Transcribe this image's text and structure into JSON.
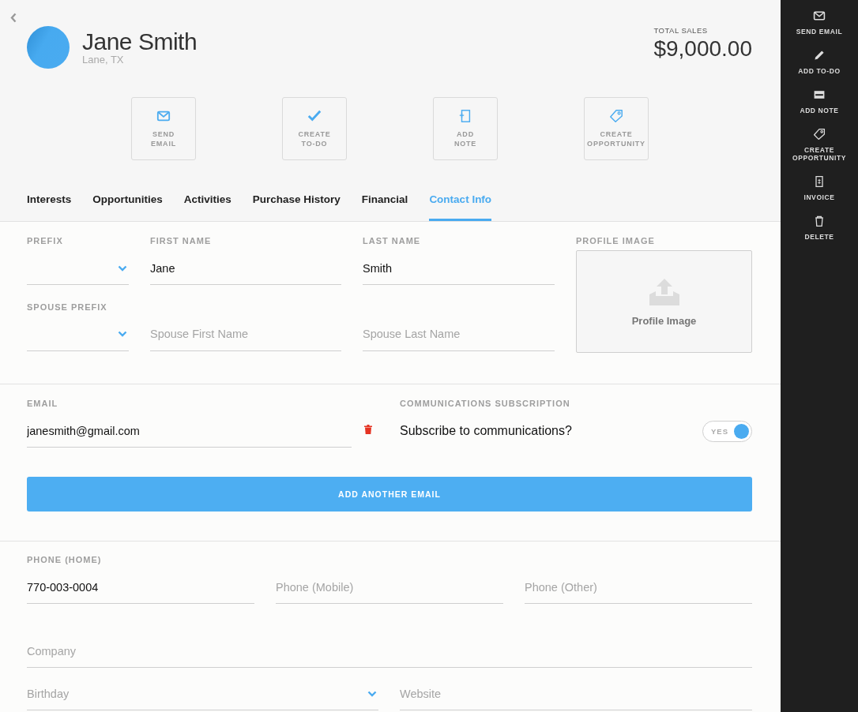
{
  "contact": {
    "name": "Jane Smith",
    "location": "Lane, TX"
  },
  "total_sales": {
    "label": "TOTAL SALES",
    "amount": "$9,000.00"
  },
  "actions": [
    {
      "label": "SEND\nEMAIL",
      "kind": "mail"
    },
    {
      "label": "CREATE\nTO-DO",
      "kind": "check"
    },
    {
      "label": "ADD\nNOTE",
      "kind": "note"
    },
    {
      "label": "CREATE\nOPPORTUNITY",
      "kind": "tag"
    }
  ],
  "tabs": [
    {
      "label": "Interests",
      "selected": false
    },
    {
      "label": "Opportunities",
      "selected": false
    },
    {
      "label": "Activities",
      "selected": false
    },
    {
      "label": "Purchase History",
      "selected": false
    },
    {
      "label": "Financial",
      "selected": false
    },
    {
      "label": "Contact Info",
      "selected": true
    }
  ],
  "name_fields": [
    {
      "label": "PREFIX",
      "kind": "select"
    },
    {
      "label": "FIRST NAME",
      "kind": "text",
      "value": "Jane"
    },
    {
      "label": "LAST NAME",
      "kind": "text",
      "value": "Smith"
    },
    {
      "label": "SPOUSE PREFIX",
      "kind": "select"
    },
    {
      "kind": "text",
      "placeholder": "Spouse First Name"
    },
    {
      "kind": "text",
      "placeholder": "Spouse Last Name"
    }
  ],
  "profile_image": {
    "label": "PROFILE IMAGE",
    "caption": "Profile Image"
  },
  "email": {
    "label": "EMAIL",
    "value": "janesmith@gmail.com"
  },
  "subscription": {
    "label": "COMMUNICATIONS SUBSCRIPTION",
    "question": "Subscribe to communications?",
    "toggle": {
      "label": "YES",
      "on": true
    }
  },
  "add_email_button": "ADD ANOTHER EMAIL",
  "phone_fields": [
    {
      "label": "PHONE (HOME)",
      "kind": "text",
      "value": "770-003-0004"
    },
    {
      "kind": "text",
      "placeholder": "Phone (Mobile)"
    },
    {
      "kind": "text",
      "placeholder": "Phone (Other)"
    }
  ],
  "company": {
    "kind": "text",
    "placeholder": "Company"
  },
  "bottom_fields": [
    {
      "kind": "select",
      "placeholder": "Birthday"
    },
    {
      "kind": "text",
      "placeholder": "Website"
    }
  ],
  "sidebar": {
    "items": [
      {
        "label": "SEND EMAIL",
        "kind": "mail"
      },
      {
        "label": "ADD TO-DO",
        "kind": "pencil"
      },
      {
        "label": "ADD NOTE",
        "kind": "card"
      },
      {
        "label": "CREATE OPPORTUNITY",
        "kind": "tag"
      },
      {
        "label": "INVOICE",
        "kind": "receipt"
      },
      {
        "label": "DELETE",
        "kind": "trash"
      }
    ]
  }
}
